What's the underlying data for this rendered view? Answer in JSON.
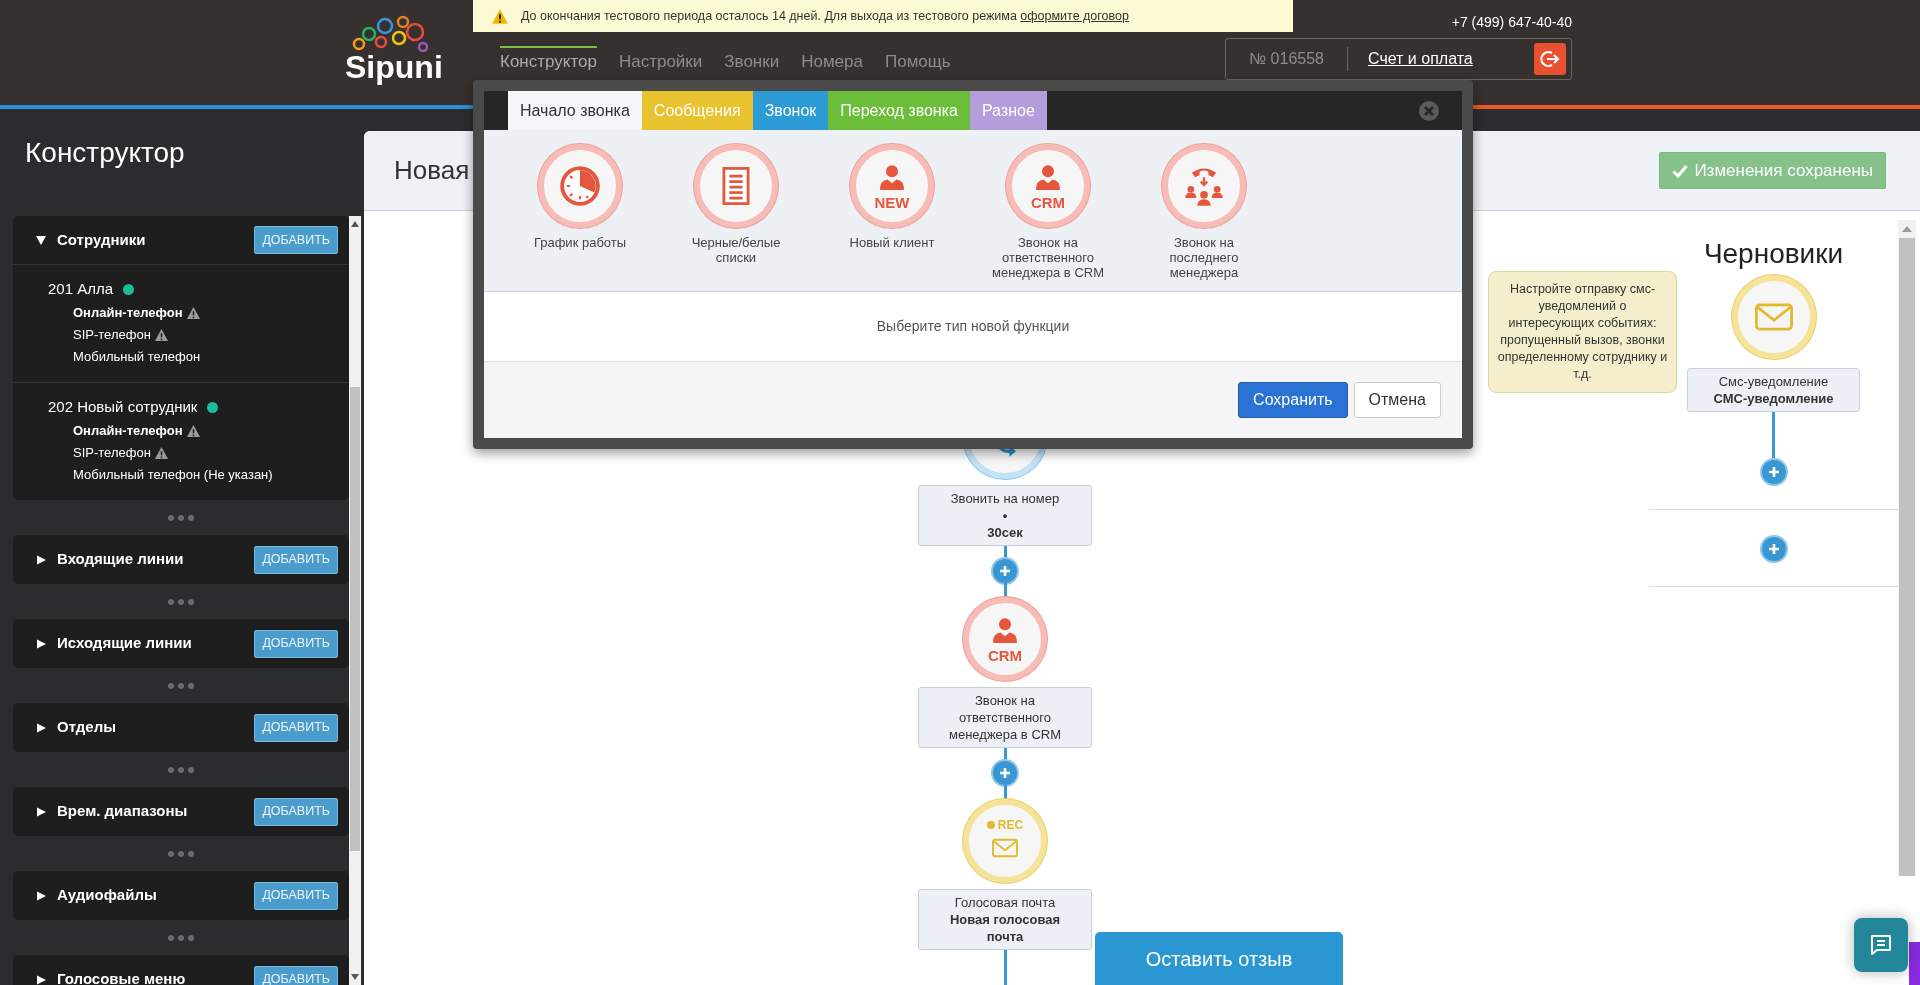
{
  "banner": {
    "text": "До окончания тестового периода осталось 14 дней. Для выхода из тестового режима",
    "link": "оформите договор"
  },
  "header": {
    "logo": "Sipuni",
    "phone": "+7 (499) 647-40-40",
    "nav": [
      {
        "label": "Конструктор",
        "selected": true
      },
      {
        "label": "Настройки",
        "selected": false
      },
      {
        "label": "Звонки",
        "selected": false
      },
      {
        "label": "Номера",
        "selected": false
      },
      {
        "label": "Помощь",
        "selected": false
      }
    ],
    "account": {
      "number": "№ 016558",
      "billing": "Счет и оплата"
    }
  },
  "sidebar": {
    "title": "Конструктор",
    "sections": [
      {
        "title": "Сотрудники",
        "expanded": true,
        "button": "ДОБАВИТЬ",
        "employees": [
          {
            "name": "201 Алла",
            "online": true,
            "phones": [
              {
                "label": "Онлайн-телефон",
                "primary": true,
                "warning": true
              },
              {
                "label": "SIP-телефон",
                "primary": false,
                "warning": true
              },
              {
                "label": "Мобильный телефон",
                "primary": false,
                "warning": false
              }
            ]
          },
          {
            "name": "202 Новый сотрудник",
            "online": true,
            "phones": [
              {
                "label": "Онлайн-телефон",
                "primary": true,
                "warning": true
              },
              {
                "label": "SIP-телефон",
                "primary": false,
                "warning": true
              },
              {
                "label": "Мобильный телефон (Не указан)",
                "primary": false,
                "warning": false
              }
            ]
          }
        ]
      },
      {
        "title": "Входящие линии",
        "expanded": false,
        "button": "ДОБАВИТЬ"
      },
      {
        "title": "Исходящие линии",
        "expanded": false,
        "button": "ДОБАВИТЬ"
      },
      {
        "title": "Отделы",
        "expanded": false,
        "button": "ДОБАВИТЬ"
      },
      {
        "title": "Врем. диапазоны",
        "expanded": false,
        "button": "ДОБАВИТЬ"
      },
      {
        "title": "Аудиофайлы",
        "expanded": false,
        "button": "ДОБАВИТЬ"
      },
      {
        "title": "Голосовые меню",
        "expanded": false,
        "button": "ДОБАВИТЬ"
      }
    ]
  },
  "main": {
    "title": "Новая",
    "status_button": "Изменения сохранены"
  },
  "flow": [
    {
      "kind": "forward",
      "lines": [
        {
          "kind": "title",
          "text": "Звонить на номер"
        },
        {
          "kind": "bullet",
          "text": "•"
        },
        {
          "kind": "value",
          "text": "30сек"
        }
      ]
    },
    {
      "kind": "person",
      "badge": "CRM",
      "lines": [
        {
          "kind": "title",
          "text": "Звонок на ответственного менеджера в CRM"
        }
      ]
    },
    {
      "kind": "envelope",
      "badge": "REC",
      "lines": [
        {
          "kind": "title",
          "text": "Голосовая почта"
        },
        {
          "kind": "value",
          "text": "Новая голосовая почта"
        }
      ]
    }
  ],
  "drafts": {
    "title": "Черновики",
    "hint": "Настройте отправку смс-уведомлений о интересующих событиях: пропущенный вызов, звонки определенному сотруднику и т.д.",
    "node": {
      "kind": "envelope",
      "lines": [
        {
          "kind": "title",
          "text": "Смс-уведомление"
        },
        {
          "kind": "value",
          "text": "СМС-уведомление"
        }
      ]
    }
  },
  "modal": {
    "tabs": [
      {
        "label": "Начало звонка",
        "color": "#f4f6f9",
        "selected": true
      },
      {
        "label": "Сообщения",
        "color": "#e9c22f",
        "selected": false
      },
      {
        "label": "Звонок",
        "color": "#2d9bd6",
        "selected": false
      },
      {
        "label": "Переход звонка",
        "color": "#6bbd3a",
        "selected": false
      },
      {
        "label": "Разное",
        "color": "#b59ddb",
        "selected": false
      }
    ],
    "functions": [
      {
        "kind": "clock",
        "label": "График работы"
      },
      {
        "kind": "list",
        "label": "Черные/белые списки"
      },
      {
        "kind": "person",
        "badge": "NEW",
        "label": "Новый клиент"
      },
      {
        "kind": "person",
        "badge": "CRM",
        "label": "Звонок на ответственного менеджера в CRM"
      },
      {
        "kind": "transfer",
        "label": "Звонок на последнего менеджера"
      }
    ],
    "message": "Выберите тип новой функции",
    "buttons": [
      {
        "kind": "primary",
        "label": "Сохранить"
      },
      {
        "kind": "secondary",
        "label": "Отмена"
      }
    ]
  },
  "feedback": "Оставить отзыв"
}
